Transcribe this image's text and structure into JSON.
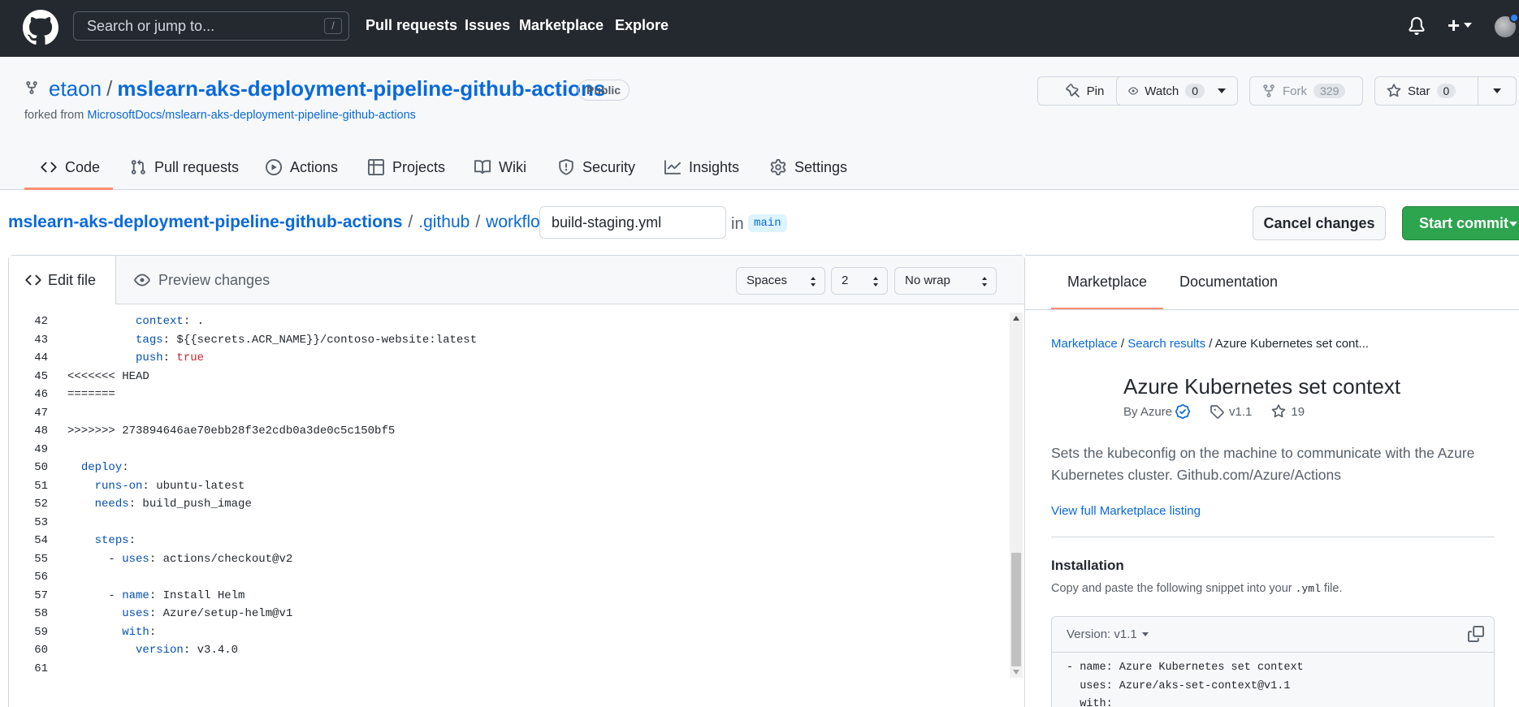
{
  "header": {
    "search_placeholder": "Search or jump to...",
    "search_shortcut": "/",
    "nav": [
      "Pull requests",
      "Issues",
      "Marketplace",
      "Explore"
    ]
  },
  "repo": {
    "owner": "etaon",
    "separator": "/",
    "name": "mslearn-aks-deployment-pipeline-github-actions",
    "visibility": "Public",
    "forked_prefix": "forked from",
    "forked_from": "MicrosoftDocs/mslearn-aks-deployment-pipeline-github-actions",
    "pin_label": "Pin",
    "watch_label": "Watch",
    "watch_count": "0",
    "fork_label": "Fork",
    "fork_count": "329",
    "star_label": "Star",
    "star_count": "0",
    "tabs": [
      "Code",
      "Pull requests",
      "Actions",
      "Projects",
      "Wiki",
      "Security",
      "Insights",
      "Settings"
    ]
  },
  "breadcrumb": {
    "root": "mslearn-aks-deployment-pipeline-github-actions",
    "dir1": ".github",
    "dir2": "workflows",
    "sep": "/",
    "filename": "build-staging.yml",
    "in_label": "in",
    "branch": "main"
  },
  "actions": {
    "cancel": "Cancel changes",
    "commit": "Start commit"
  },
  "editor": {
    "tab_edit": "Edit file",
    "tab_preview": "Preview changes",
    "indent_mode": "Spaces",
    "indent_size": "2",
    "wrap_mode": "No wrap",
    "lines": [
      {
        "n": "42",
        "indent": "          ",
        "key": "context",
        "val": " .",
        "type": "kv"
      },
      {
        "n": "43",
        "indent": "          ",
        "key": "tags",
        "val": " ${{secrets.ACR_NAME}}/contoso-website:latest",
        "type": "kv"
      },
      {
        "n": "44",
        "indent": "          ",
        "key": "push",
        "val": " true",
        "type": "kvbool"
      },
      {
        "n": "45",
        "text": "<<<<<<< HEAD",
        "type": "plain"
      },
      {
        "n": "46",
        "text": "=======",
        "type": "plain"
      },
      {
        "n": "47",
        "text": "",
        "type": "plain"
      },
      {
        "n": "48",
        "text": ">>>>>>> 273894646ae70ebb28f3e2cdb0a3de0c5c150bf5",
        "type": "plain"
      },
      {
        "n": "49",
        "text": "",
        "type": "plain"
      },
      {
        "n": "50",
        "indent": "  ",
        "key": "deploy",
        "val": "",
        "type": "kv"
      },
      {
        "n": "51",
        "indent": "    ",
        "key": "runs-on",
        "val": " ubuntu-latest",
        "type": "kv"
      },
      {
        "n": "52",
        "indent": "    ",
        "key": "needs",
        "val": " build_push_image",
        "type": "kv"
      },
      {
        "n": "53",
        "text": "",
        "type": "plain"
      },
      {
        "n": "54",
        "indent": "    ",
        "key": "steps",
        "val": "",
        "type": "kv"
      },
      {
        "n": "55",
        "indent": "      - ",
        "key": "uses",
        "val": " actions/checkout@v2",
        "type": "kv"
      },
      {
        "n": "56",
        "text": "",
        "type": "plain"
      },
      {
        "n": "57",
        "indent": "      - ",
        "key": "name",
        "val": " Install Helm",
        "type": "kv"
      },
      {
        "n": "58",
        "indent": "        ",
        "key": "uses",
        "val": " Azure/setup-helm@v1",
        "type": "kv"
      },
      {
        "n": "59",
        "indent": "        ",
        "key": "with",
        "val": "",
        "type": "kv"
      },
      {
        "n": "60",
        "indent": "          ",
        "key": "version",
        "val": " v3.4.0",
        "type": "kv"
      },
      {
        "n": "61",
        "text": "",
        "type": "plain"
      }
    ]
  },
  "panel": {
    "tab_marketplace": "Marketplace",
    "tab_docs": "Documentation",
    "crumb_marketplace": "Marketplace",
    "crumb_search": "Search results",
    "crumb_current": "Azure Kubernetes set cont...",
    "crumb_sep": "/",
    "title": "Azure Kubernetes set context",
    "by": "By Azure",
    "version": "v1.1",
    "stars": "19",
    "description": "Sets the kubeconfig on the machine to communicate with the Azure Kubernetes cluster. Github.com/Azure/Actions",
    "full_listing": "View full Marketplace listing",
    "install_heading": "Installation",
    "install_pre": "Copy and paste the following snippet into your",
    "install_code": ".yml",
    "install_post": "file.",
    "version_label": "Version: v1.1",
    "snippet": "- name: Azure Kubernetes set context\n  uses: Azure/aks-set-context@v1.1\n  with:"
  },
  "colors": {
    "header_bg": "#24292f",
    "link": "#0969da",
    "primary_btn": "#2da44e",
    "tab_accent": "#fd8c73"
  }
}
